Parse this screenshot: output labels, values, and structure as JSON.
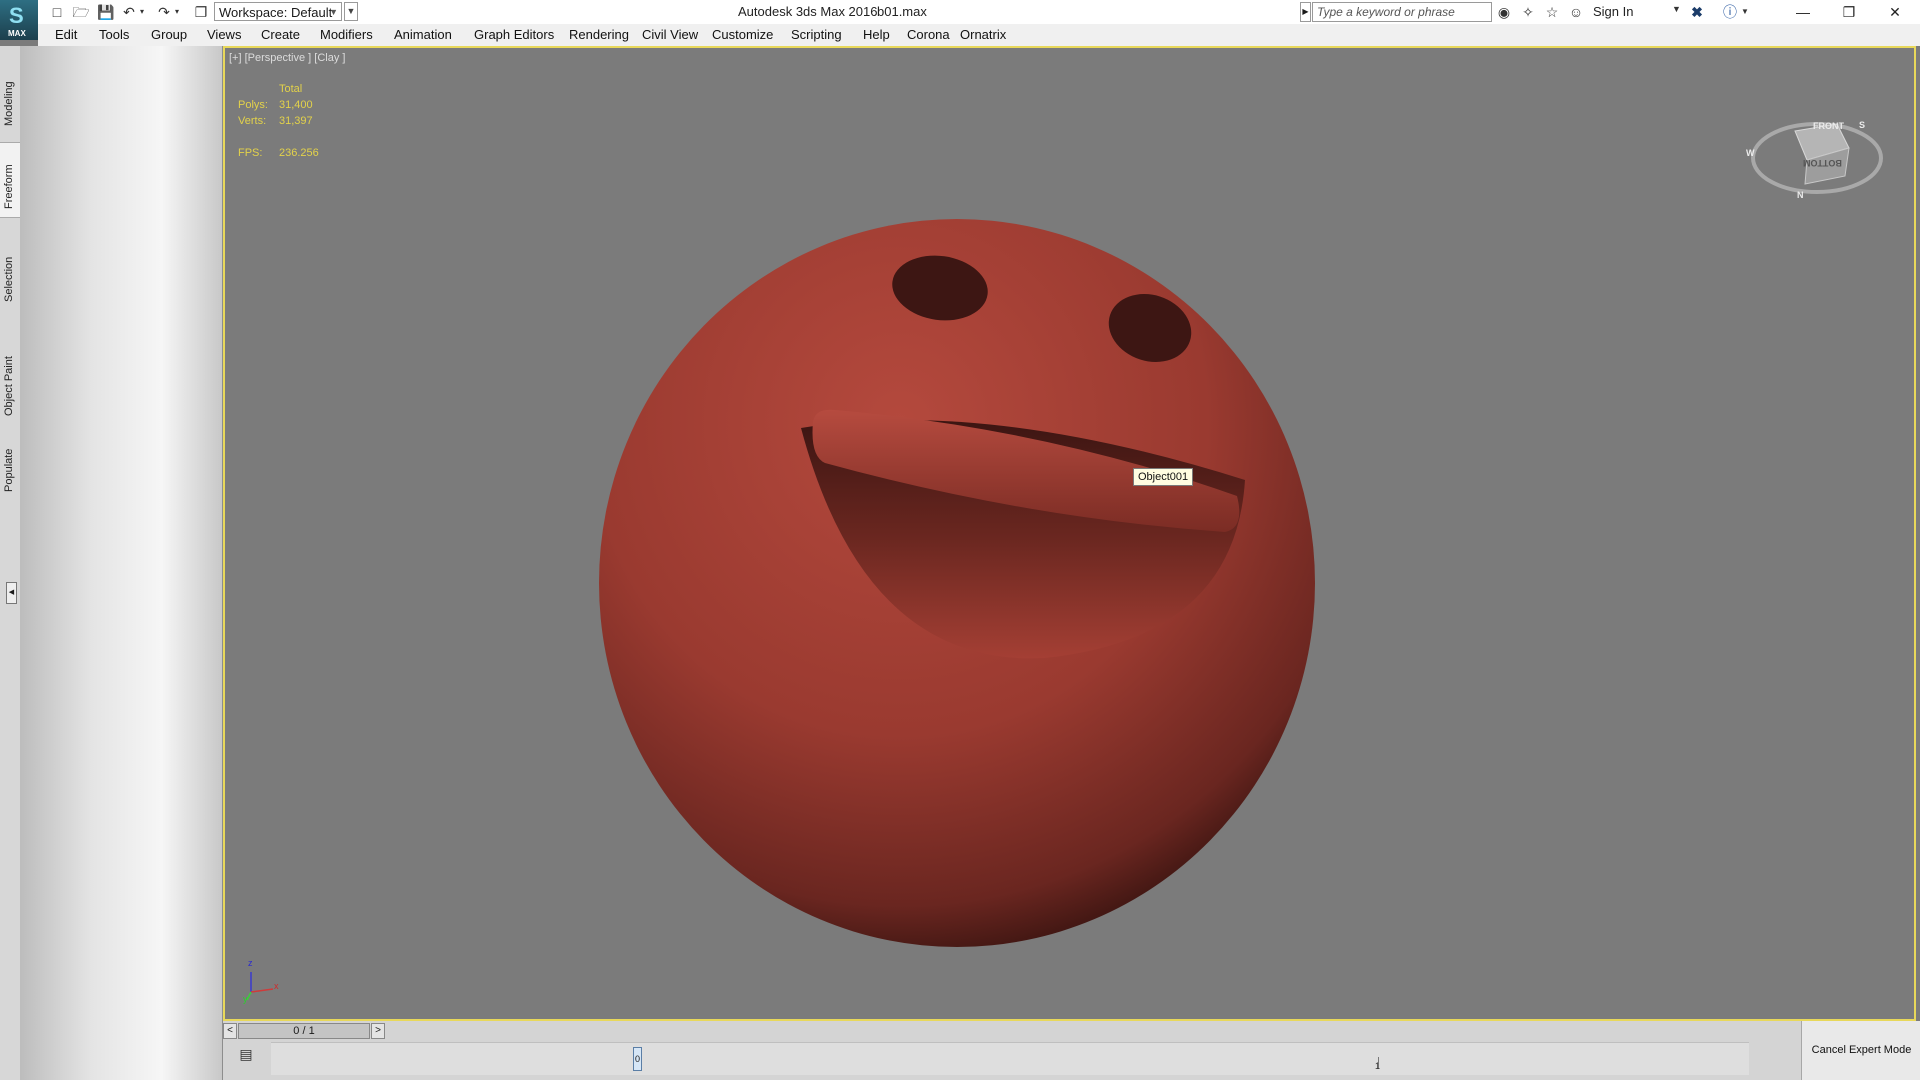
{
  "title_bar": {
    "app_name": "Autodesk 3ds Max 2016",
    "file_name": "b01.max",
    "logo_text": "MAX",
    "workspace_label": "Workspace: Default",
    "search_placeholder": "Type a keyword or phrase",
    "sign_in_label": "Sign In",
    "quick_access_icons": [
      "new-icon",
      "open-icon",
      "save-icon",
      "undo-icon",
      "redo-icon",
      "project-icon"
    ],
    "window_controls": [
      "minimize-icon",
      "restore-icon",
      "close-icon"
    ]
  },
  "menu": {
    "items": [
      "Edit",
      "Tools",
      "Group",
      "Views",
      "Create",
      "Modifiers",
      "Animation",
      "Graph Editors",
      "Rendering",
      "Civil View",
      "Customize",
      "Scripting",
      "Help",
      "Corona",
      "Ornatrix"
    ]
  },
  "ribbon": {
    "tabs": [
      "Modeling",
      "Freeform",
      "Selection",
      "Object Paint",
      "Populate"
    ],
    "active_tab": "Freeform"
  },
  "viewport": {
    "label": "[+] [Perspective ] [Clay ]",
    "stats": {
      "total_header": "Total",
      "polys_label": "Polys:",
      "polys_value": "31,400",
      "verts_label": "Verts:",
      "verts_value": "31,397",
      "fps_label": "FPS:",
      "fps_value": "236.256"
    },
    "tooltip": "Object001",
    "viewcube_top": "FRONT",
    "viewcube_face": "BOTTOM",
    "compass": [
      "W",
      "N",
      "S"
    ],
    "axis": [
      "z",
      "x",
      "y"
    ],
    "colors": {
      "border_active": "#e8d85a",
      "stats_text": "#e3d24a",
      "mesh": "#a9443a",
      "background": "#7b7b7b"
    }
  },
  "timeline": {
    "frame_counter": "0 / 1",
    "prev_label": "<",
    "next_label": ">",
    "key_label": "0",
    "tick_label": "1",
    "expert_button": "Cancel Expert Mode"
  }
}
